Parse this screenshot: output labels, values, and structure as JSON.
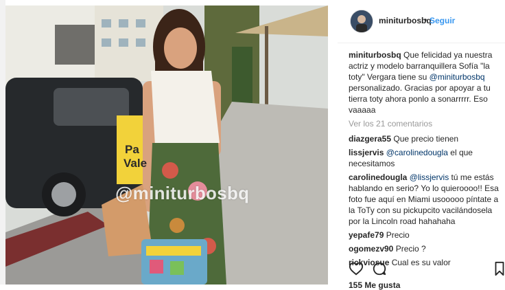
{
  "post": {
    "watermark": "@miniturbosbq",
    "sign_text_1": "Pa",
    "sign_text_2": "Vale"
  },
  "header": {
    "username": "miniturbosbq",
    "separator": "•",
    "follow_label": "Seguir"
  },
  "caption": {
    "user": "miniturbosbq",
    "text_before": " Que felicidad ya nuestra actriz y modelo barranquillera Sofía \"la toty\" Vergara tiene su ",
    "mention": "@miniturbosbq",
    "text_after": " personalizado. Gracias por apoyar a tu tierra toty ahora ponlo a sonarrrrr. Eso vaaaaa"
  },
  "view_all": "Ver los 21 comentarios",
  "comments": [
    {
      "user": "diazgera55",
      "text": " Que precio tienen",
      "mention": ""
    },
    {
      "user": "lissjervis",
      "text": " el que necesitamos",
      "mention": " @carolinedougla"
    },
    {
      "user": "carolinedougla",
      "text": " tú me estás hablando en serio? Yo lo quieroooo!! Esa foto fue aquí en Miami usooooo píntate a la ToTy con su pickupcito vacilándosela por la Lincoln road hahahaha",
      "mention": " @lissjervis"
    },
    {
      "user": "yepafe79",
      "text": " Precio",
      "mention": ""
    },
    {
      "user": "ogomezv90",
      "text": " Precio ?",
      "mention": ""
    },
    {
      "user": "rickviosue",
      "text": " Cual es su valor",
      "mention": ""
    }
  ],
  "likes_text": "155 Me gusta",
  "icons": [
    "heart-icon",
    "comment-icon",
    "bookmark-icon"
  ],
  "colors": {
    "link": "#3897f0",
    "mention": "#003569",
    "muted": "#999999",
    "text": "#262626"
  }
}
